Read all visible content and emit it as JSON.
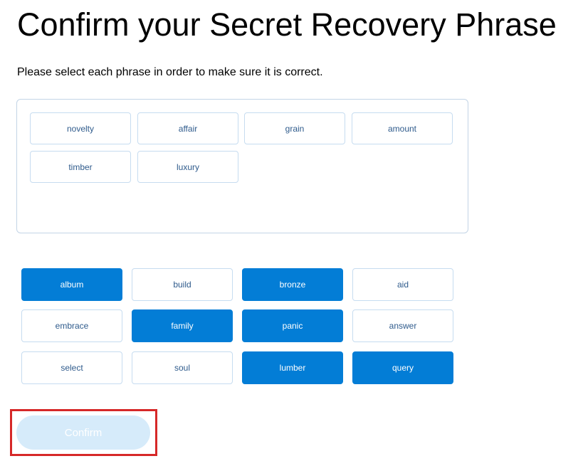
{
  "page": {
    "title": "Confirm your Secret Recovery Phrase",
    "instruction": "Please select each phrase in order to make sure it is correct."
  },
  "selected_words": [
    "novelty",
    "affair",
    "grain",
    "amount",
    "timber",
    "luxury"
  ],
  "word_options": [
    {
      "label": "album",
      "state": "filled"
    },
    {
      "label": "build",
      "state": "outline"
    },
    {
      "label": "bronze",
      "state": "filled"
    },
    {
      "label": "aid",
      "state": "outline"
    },
    {
      "label": "embrace",
      "state": "outline"
    },
    {
      "label": "family",
      "state": "filled"
    },
    {
      "label": "panic",
      "state": "filled"
    },
    {
      "label": "answer",
      "state": "outline"
    },
    {
      "label": "select",
      "state": "outline"
    },
    {
      "label": "soul",
      "state": "outline"
    },
    {
      "label": "lumber",
      "state": "filled"
    },
    {
      "label": "query",
      "state": "filled"
    }
  ],
  "confirm_button": {
    "label": "Confirm",
    "enabled": false
  },
  "colors": {
    "accent": "#037dd6",
    "chip_border": "#c6dcf0",
    "confirm_disabled_bg": "#d6ebfa",
    "highlight": "#d62828"
  }
}
